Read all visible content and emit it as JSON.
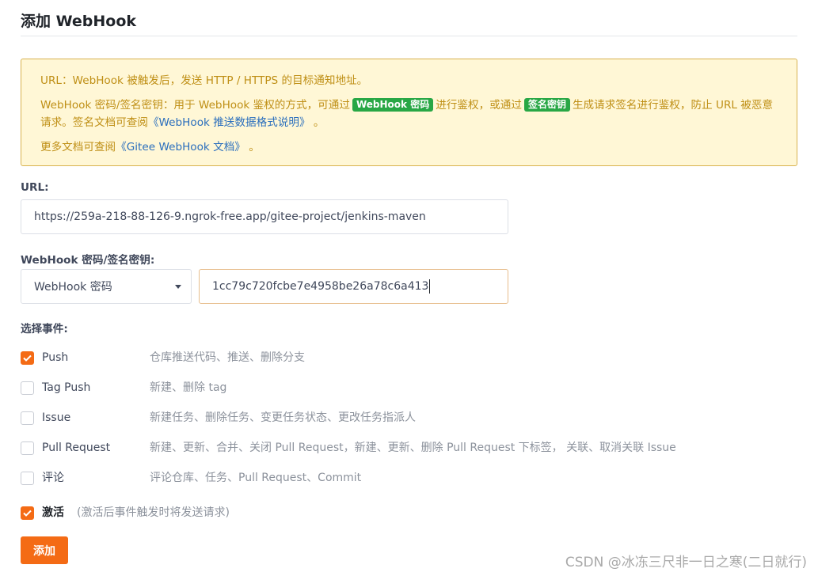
{
  "page": {
    "title": "添加 WebHook"
  },
  "notice": {
    "line1": "URL：WebHook 被触发后，发送 HTTP / HTTPS 的目标通知地址。",
    "line2_a": "WebHook 密码/签名密钥：用于 WebHook 鉴权的方式，可通过",
    "tag_password": "WebHook 密码",
    "line2_b": "进行鉴权，或通过",
    "tag_sign": "签名密钥",
    "line2_c": "生成请求签名进行鉴权，防止 URL 被恶意请求。签名文档可查阅",
    "link_push_doc": "《WebHook 推送数据格式说明》",
    "line2_end": "。",
    "line3_a": "更多文档可查阅",
    "link_gitee_doc": "《Gitee WebHook 文档》",
    "line3_end": "。"
  },
  "url_field": {
    "label": "URL:",
    "value": "https://259a-218-88-126-9.ngrok-free.app/gitee-project/jenkins-maven"
  },
  "secret": {
    "label": "WebHook 密码/签名密钥:",
    "type_selected": "WebHook 密码",
    "value": "1cc79c720fcbe7e4958be26a78c6a413"
  },
  "events": {
    "label": "选择事件:",
    "items": [
      {
        "name": "Push",
        "desc": "仓库推送代码、推送、删除分支",
        "checked": true
      },
      {
        "name": "Tag Push",
        "desc": "新建、删除 tag",
        "checked": false
      },
      {
        "name": "Issue",
        "desc": "新建任务、删除任务、变更任务状态、更改任务指派人",
        "checked": false
      },
      {
        "name": "Pull Request",
        "desc": "新建、更新、合并、关闭 Pull Request，新建、更新、删除 Pull Request 下标签， 关联、取消关联 Issue",
        "checked": false
      },
      {
        "name": "评论",
        "desc": "评论仓库、任务、Pull Request、Commit",
        "checked": false
      }
    ]
  },
  "activate": {
    "label": "激活",
    "hint": "(激活后事件触发时将发送请求)",
    "checked": true
  },
  "submit": {
    "label": "添加"
  },
  "watermark": "CSDN @冰冻三尺非一日之寒(二日就行)",
  "colors": {
    "accent": "#f46b15",
    "notice_bg": "#fff7d6",
    "notice_text": "#bf8f15",
    "tag_green": "#28a745",
    "link": "#2a6ebd"
  }
}
